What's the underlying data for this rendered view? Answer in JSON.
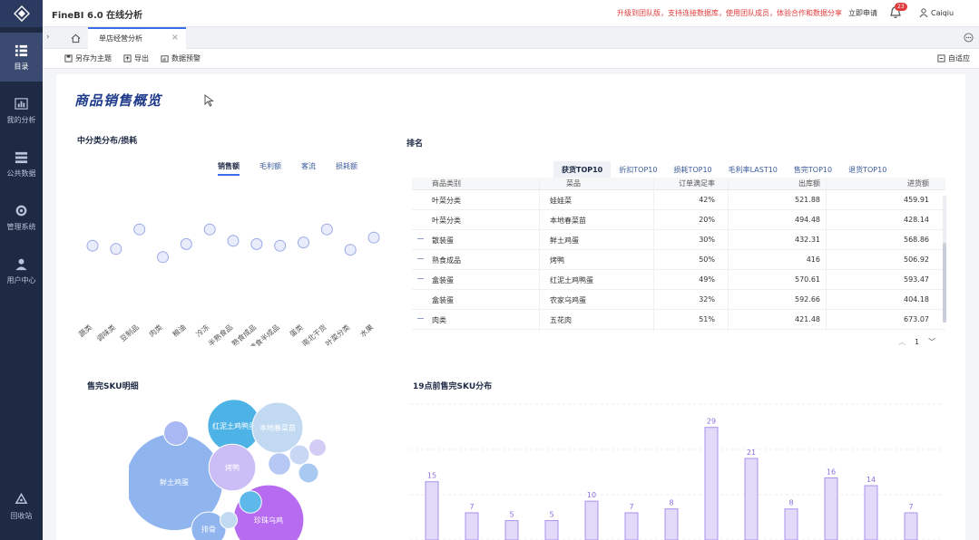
{
  "app": {
    "title": "FineBI 6.0 在线分析",
    "promo": "升级到团队版，支持连接数据库，使用团队成员，体验合作和数据分享",
    "update": "立即申请",
    "notif_count": "23",
    "user": "Caiqiu"
  },
  "sidebar": {
    "items": [
      {
        "label": "目录",
        "icon": "directory-icon"
      },
      {
        "label": "我的分析",
        "icon": "analysis-icon"
      },
      {
        "label": "公共数据",
        "icon": "database-icon"
      },
      {
        "label": "管理系统",
        "icon": "management-icon"
      },
      {
        "label": "用户中心",
        "icon": "user-center-icon"
      },
      {
        "label": "回收站",
        "icon": "recycle-icon"
      }
    ]
  },
  "tabs": {
    "active": "单店经营分析"
  },
  "toolbar": {
    "save_as_theme": "另存为主题",
    "export": "导出",
    "preview": "数据预警",
    "auto_refresh": "自适应"
  },
  "dashboard": {
    "title": "商品销售概览",
    "left_section": "中分类分布/损耗",
    "left_tabs": [
      "销售额",
      "毛利额",
      "客流",
      "损耗额"
    ],
    "right_section": "排名",
    "right_tabs": [
      "获货TOP10",
      "折扣TOP10",
      "损耗TOP10",
      "毛利率LAST10",
      "售完TOP10",
      "退货TOP10"
    ],
    "table": {
      "headers": [
        "商品类别",
        "菜品",
        "订单满足率",
        "出库额",
        "进货额"
      ],
      "rows": [
        [
          "叶菜分类",
          "娃娃菜",
          "42%",
          "521.88",
          "459.91"
        ],
        [
          "叶菜分类",
          "本地春菜苗",
          "20%",
          "494.48",
          "428.14"
        ],
        [
          "散装蛋",
          "鲜土鸡蛋",
          "30%",
          "432.31",
          "568.86"
        ],
        [
          "熟食成品",
          "烤鸭",
          "50%",
          "416",
          "506.92"
        ],
        [
          "盒装蛋",
          "红泥土鸡鸭蛋",
          "49%",
          "570.61",
          "593.47"
        ],
        [
          "盒装蛋",
          "农家乌鸡蛋",
          "32%",
          "592.66",
          "404.18"
        ],
        [
          "肉类",
          "五花肉",
          "51%",
          "421.48",
          "673.07"
        ]
      ],
      "page": "1"
    },
    "bottom_left_section": "售完SKU明细",
    "bottom_right_section": "19点前售完SKU分布"
  },
  "chart_data": [
    {
      "type": "scatter",
      "title": "中分类分布/损耗",
      "categories": [
        "蔬类",
        "调味类",
        "豆制品",
        "肉类",
        "粮油",
        "冷冻",
        "半熟食品",
        "熟食成品",
        "速食半成品",
        "蛋类",
        "南北干货",
        "叶菜分类",
        "水果"
      ],
      "values": [
        52,
        48,
        72,
        38,
        54,
        72,
        58,
        54,
        52,
        56,
        72,
        47,
        62
      ],
      "ylim": [
        0,
        100
      ]
    },
    {
      "type": "bubble",
      "title": "售完SKU明细",
      "items": [
        {
          "label": "红泥土鸡鸭蛋",
          "value": 28,
          "color": "#4db3e6"
        },
        {
          "label": "本地春菜苗",
          "value": 26,
          "color": "#c2d9f2"
        },
        {
          "label": "鲜土鸡蛋",
          "value": 95,
          "color": "#8fb4ee"
        },
        {
          "label": "烤鸭",
          "value": 22,
          "color": "#cbbdf6"
        },
        {
          "label": "珍珠乌鸡",
          "value": 50,
          "color": "#b76bf0"
        },
        {
          "label": "排骨",
          "value": 12,
          "color": "#8fb4ee"
        },
        {
          "label": "",
          "value": 6,
          "color": "#a9b8f2"
        },
        {
          "label": "",
          "value": 5,
          "color": "#5eb8ea"
        },
        {
          "label": "",
          "value": 5,
          "color": "#b8c8f4"
        },
        {
          "label": "",
          "value": 4,
          "color": "#c7d7f4"
        },
        {
          "label": "",
          "value": 4,
          "color": "#a9c9f0"
        },
        {
          "label": "",
          "value": 3,
          "color": "#d3ccf4"
        },
        {
          "label": "",
          "value": 3,
          "color": "#c2d9f2"
        }
      ]
    },
    {
      "type": "bar",
      "title": "19点前售完SKU分布",
      "values": [
        15,
        7,
        5,
        5,
        10,
        7,
        8,
        29,
        21,
        8,
        16,
        14,
        7
      ],
      "ylim": [
        0,
        35
      ]
    }
  ]
}
